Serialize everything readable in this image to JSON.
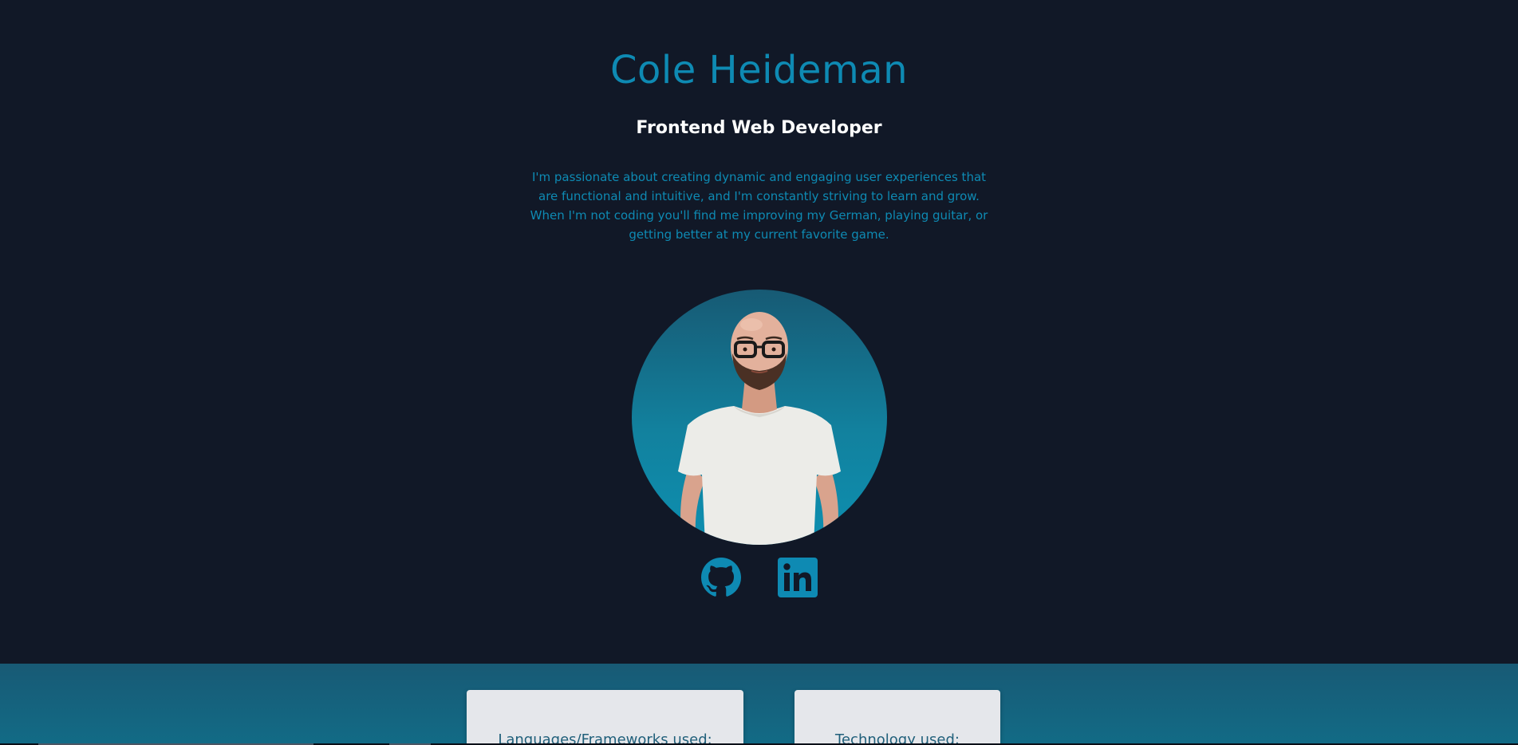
{
  "profile": {
    "name": "Cole Heideman",
    "role": "Frontend Web Developer",
    "bio": "I'm passionate about creating dynamic and engaging user experiences that are functional and intuitive, and I'm constantly striving to learn and grow. When I'm not coding you'll find me improving my German, playing guitar, or getting better at my current favorite game."
  },
  "social": {
    "github_icon": "github-icon",
    "linkedin_icon": "linkedin-icon"
  },
  "skills": {
    "languages_title": "Languages/Frameworks used:",
    "technology_title": "Technology used:"
  },
  "colors": {
    "background": "#111827",
    "accent": "#0e8ab3",
    "section_band": "#185a75",
    "card": "#e5e7eb"
  }
}
